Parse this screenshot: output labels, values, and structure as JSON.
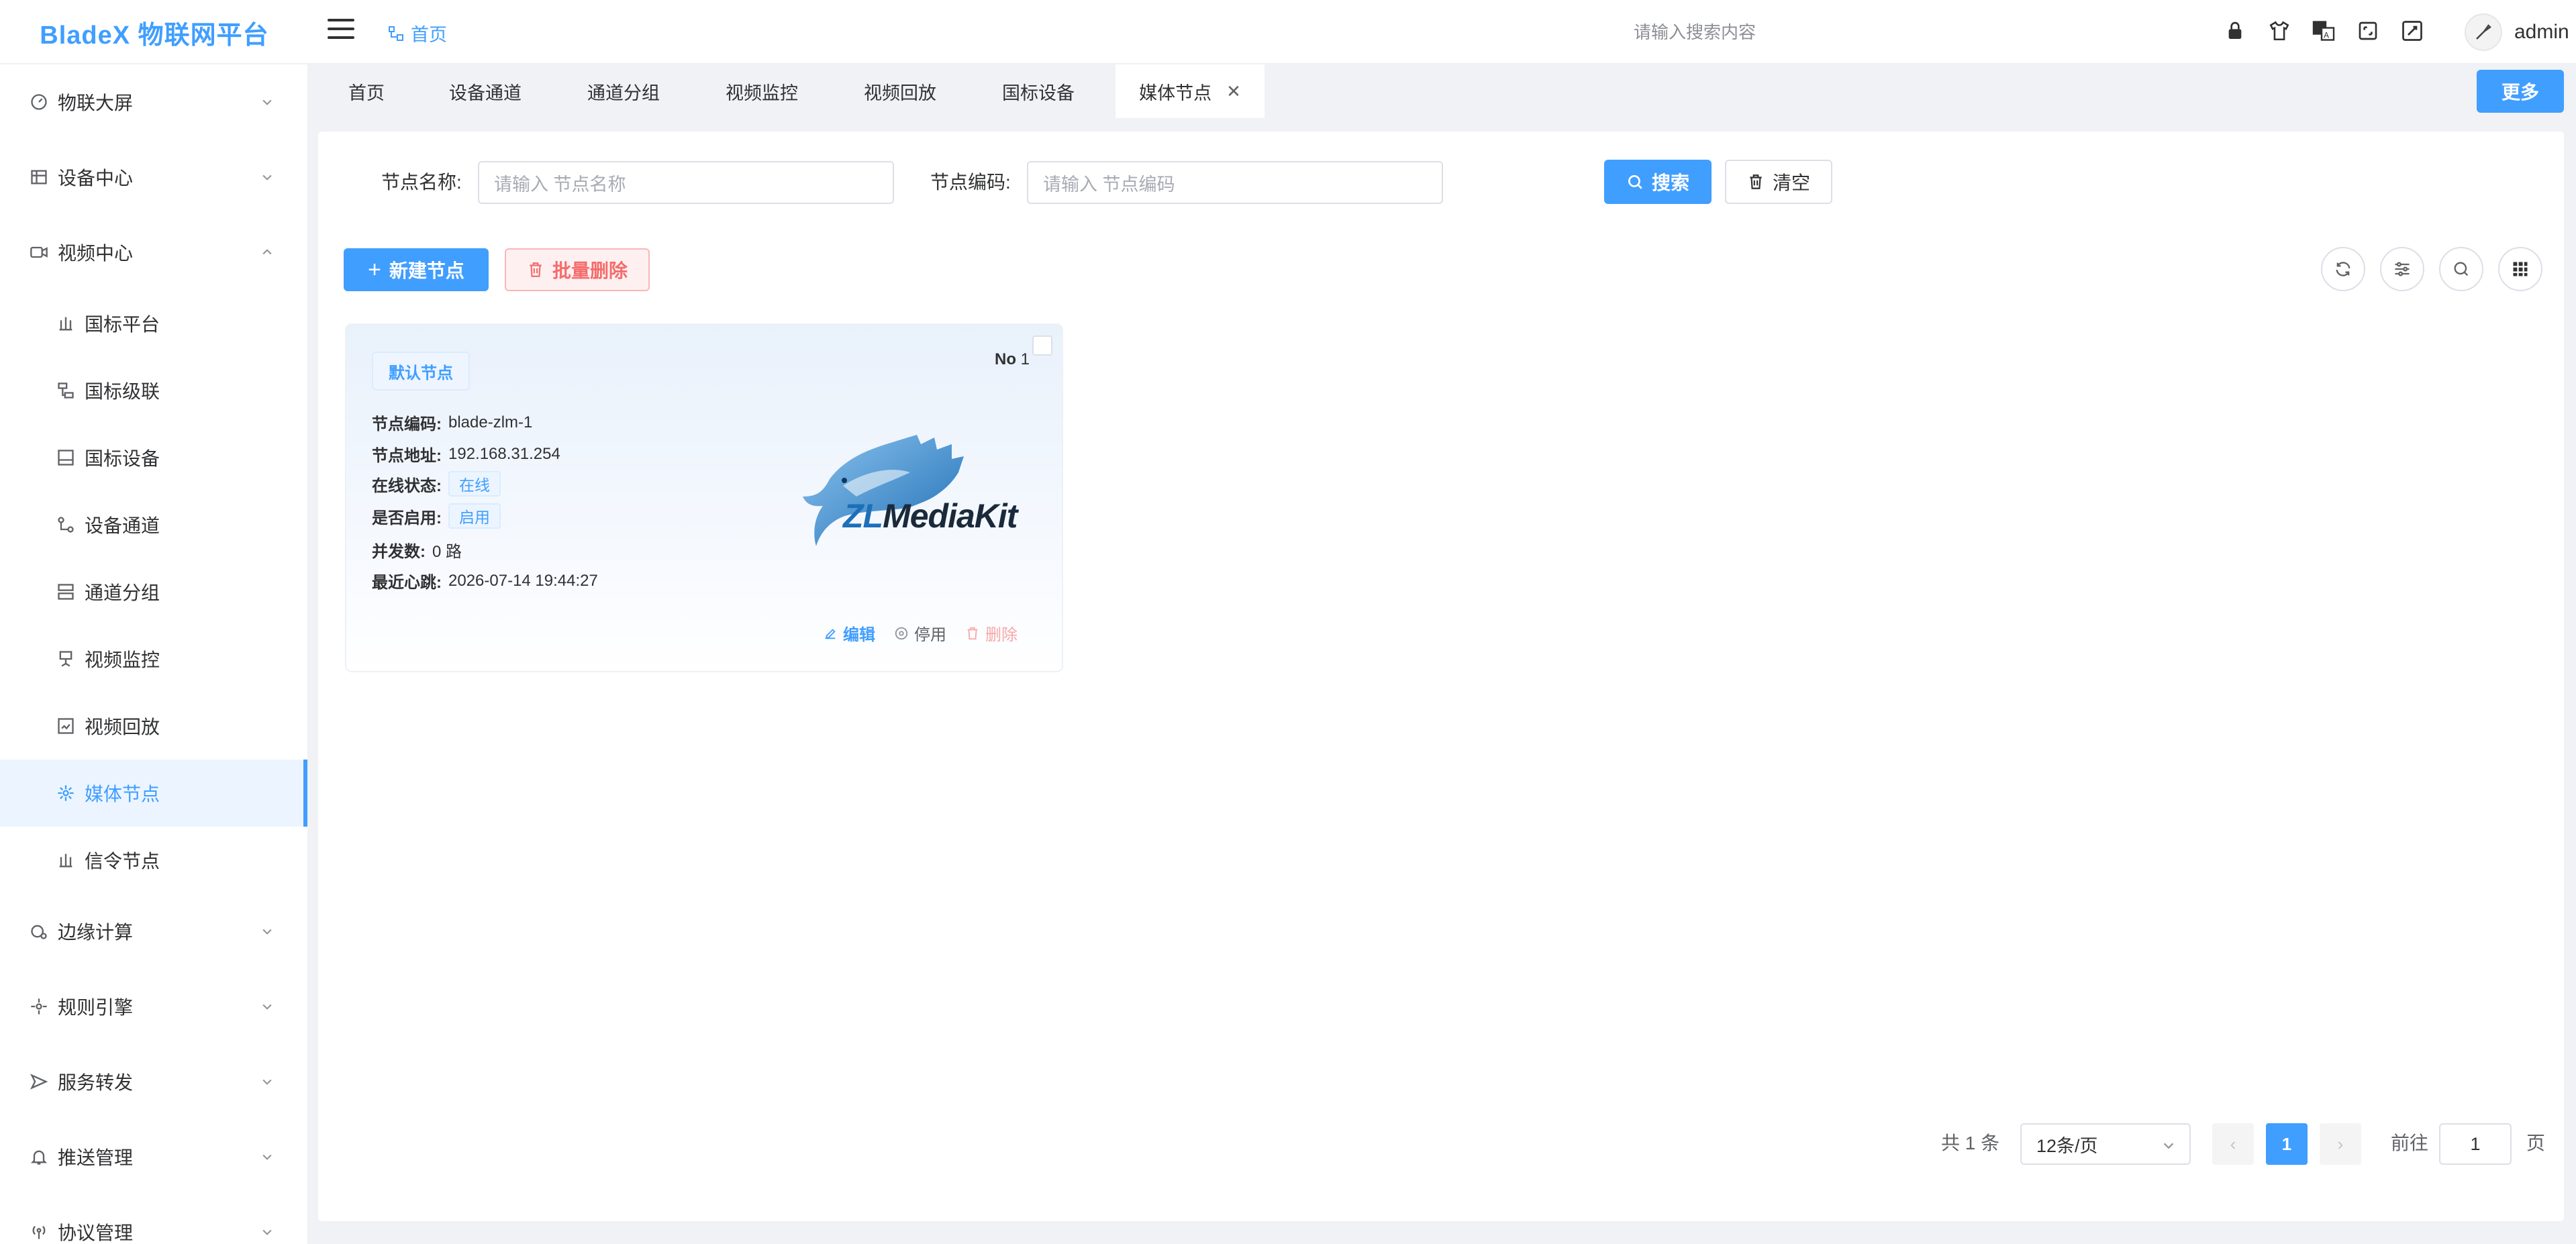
{
  "app": {
    "title": "BladeX 物联网平台"
  },
  "header": {
    "breadcrumb": "首页",
    "search_placeholder": "请输入搜索内容",
    "username": "admin",
    "icons": [
      "lock-icon",
      "theme-icon",
      "language-icon",
      "fullscreen-icon",
      "settings-icon"
    ]
  },
  "sidebar": {
    "items": [
      {
        "label": "物联大屏",
        "icon": "dashboard-icon",
        "expanded": false
      },
      {
        "label": "设备中心",
        "icon": "device-icon",
        "expanded": false
      },
      {
        "label": "视频中心",
        "icon": "video-icon",
        "expanded": true
      },
      {
        "label": "边缘计算",
        "icon": "edge-icon",
        "expanded": false
      },
      {
        "label": "规则引擎",
        "icon": "rule-icon",
        "expanded": false
      },
      {
        "label": "服务转发",
        "icon": "send-icon",
        "expanded": false
      },
      {
        "label": "推送管理",
        "icon": "bell-icon",
        "expanded": false
      },
      {
        "label": "协议管理",
        "icon": "protocol-icon",
        "expanded": false
      }
    ],
    "video_children": [
      {
        "label": "国标平台",
        "icon": "platform-icon"
      },
      {
        "label": "国标级联",
        "icon": "cascade-icon"
      },
      {
        "label": "国标设备",
        "icon": "gb-device-icon"
      },
      {
        "label": "设备通道",
        "icon": "channel-icon"
      },
      {
        "label": "通道分组",
        "icon": "group-icon"
      },
      {
        "label": "视频监控",
        "icon": "camera-icon"
      },
      {
        "label": "视频回放",
        "icon": "playback-icon"
      },
      {
        "label": "媒体节点",
        "icon": "node-icon",
        "active": true
      },
      {
        "label": "信令节点",
        "icon": "signal-icon"
      }
    ]
  },
  "tabs": {
    "items": [
      "首页",
      "设备通道",
      "通道分组",
      "视频监控",
      "视频回放",
      "国标设备",
      "媒体节点"
    ],
    "active": "媒体节点",
    "more_label": "更多"
  },
  "search": {
    "name_label": "节点名称:",
    "name_placeholder": "请输入 节点名称",
    "code_label": "节点编码:",
    "code_placeholder": "请输入 节点编码",
    "search_btn": "搜索",
    "clear_btn": "清空"
  },
  "toolbar": {
    "add_btn": "新建节点",
    "batch_delete_btn": "批量删除",
    "icons": [
      "refresh-icon",
      "filter-icon",
      "search-icon",
      "columns-icon"
    ]
  },
  "card": {
    "tag": "默认节点",
    "no_label": "No",
    "no_value": "1",
    "fields": [
      {
        "key": "节点编码:",
        "value": "blade-zlm-1"
      },
      {
        "key": "节点地址:",
        "value": "192.168.31.254"
      },
      {
        "key": "在线状态:",
        "value": "在线",
        "pill": true
      },
      {
        "key": "是否启用:",
        "value": "启用",
        "pill": true
      },
      {
        "key": "并发数:",
        "value": "0 路"
      },
      {
        "key": "最近心跳:",
        "value": "2026-07-14 19:44:27"
      }
    ],
    "logo_text_zl": "ZL",
    "logo_text_rest": "MediaKit",
    "actions": {
      "edit": "编辑",
      "disable": "停用",
      "delete": "删除"
    }
  },
  "pagination": {
    "total": "共 1 条",
    "page_size": "12条/页",
    "current": "1",
    "prev": "‹",
    "next": "›",
    "goto_label": "前往",
    "goto_value": "1",
    "page_unit": "页"
  },
  "colors": {
    "primary": "#409eff",
    "danger": "#f56c6c",
    "text": "#303133"
  }
}
